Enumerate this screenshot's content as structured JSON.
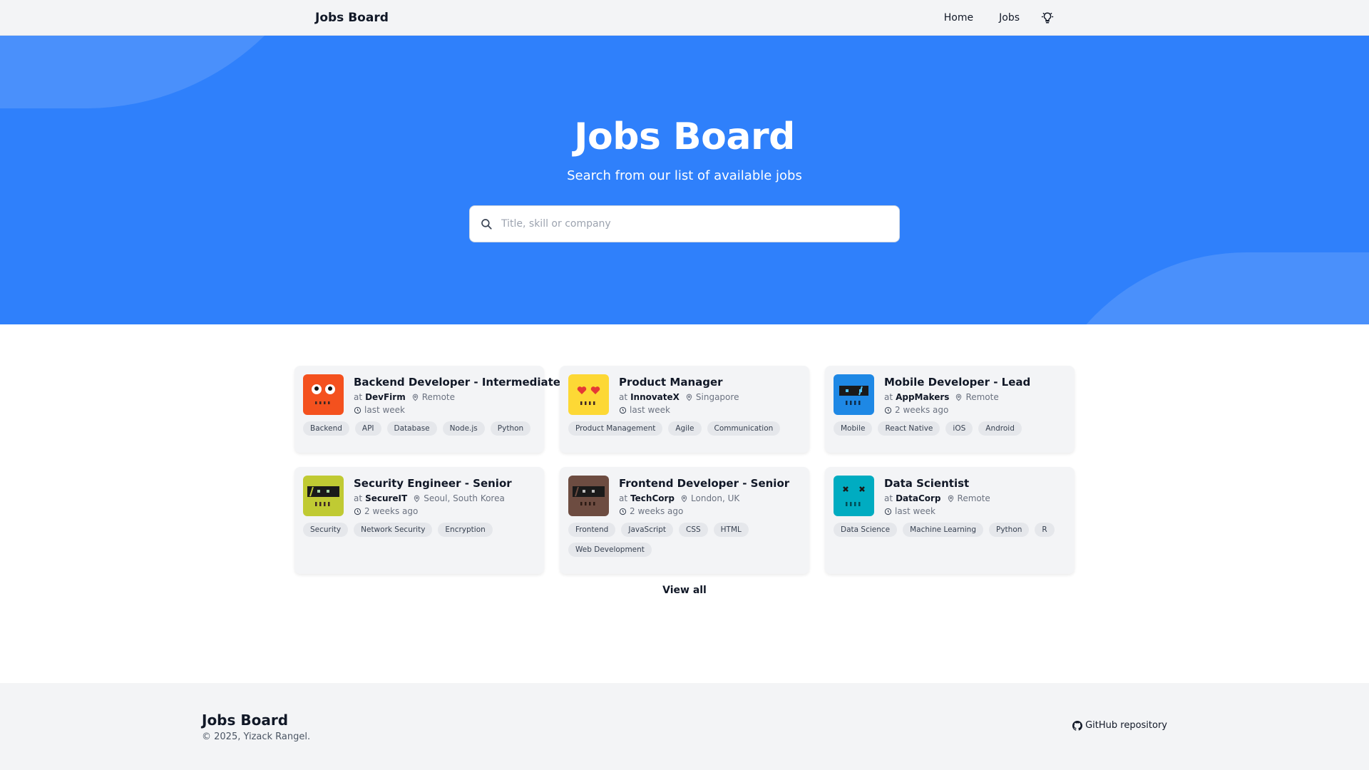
{
  "navbar": {
    "brand": "Jobs Board",
    "links": [
      "Home",
      "Jobs"
    ],
    "theme_icon": "lightbulb-icon"
  },
  "hero": {
    "title": "Jobs Board",
    "subtitle": "Search from our list of available jobs",
    "search_placeholder": "Title, skill or company",
    "search_value": ""
  },
  "jobs": [
    {
      "title": "Backend Developer - Intermediate",
      "at": "at",
      "company": "DevFirm",
      "location": "Remote",
      "posted": "last week",
      "logo_color": "#f4511e",
      "tags": [
        "Backend",
        "API",
        "Database",
        "Node.js",
        "Python"
      ]
    },
    {
      "title": "Product Manager",
      "at": "at",
      "company": "InnovateX",
      "location": "Singapore",
      "posted": "last week",
      "logo_color": "#fdd835",
      "tags": [
        "Product Management",
        "Agile",
        "Communication"
      ]
    },
    {
      "title": "Mobile Developer - Lead",
      "at": "at",
      "company": "AppMakers",
      "location": "Remote",
      "posted": "2 weeks ago",
      "logo_color": "#1e88e5",
      "tags": [
        "Mobile",
        "React Native",
        "iOS",
        "Android"
      ]
    },
    {
      "title": "Security Engineer - Senior",
      "at": "at",
      "company": "SecureIT",
      "location": "Seoul, South Korea",
      "posted": "2 weeks ago",
      "logo_color": "#c0ca33",
      "tags": [
        "Security",
        "Network Security",
        "Encryption"
      ]
    },
    {
      "title": "Frontend Developer - Senior",
      "at": "at",
      "company": "TechCorp",
      "location": "London, UK",
      "posted": "2 weeks ago",
      "logo_color": "#6d4c41",
      "tags": [
        "Frontend",
        "JavaScript",
        "CSS",
        "HTML",
        "Web Development"
      ]
    },
    {
      "title": "Data Scientist",
      "at": "at",
      "company": "DataCorp",
      "location": "Remote",
      "posted": "last week",
      "logo_color": "#00acc1",
      "tags": [
        "Data Science",
        "Machine Learning",
        "Python",
        "R"
      ]
    }
  ],
  "view_all": "View all",
  "footer": {
    "brand": "Jobs Board",
    "copyright": "© 2025, Yizack Rangel.",
    "github_label": "GitHub repository",
    "github_icon": "github-icon"
  },
  "colors": {
    "hero_bg": "#2f80fb",
    "hero_blob": "#4a90fb",
    "card_bg": "#f3f4f6",
    "tag_bg": "#e5e7eb"
  }
}
